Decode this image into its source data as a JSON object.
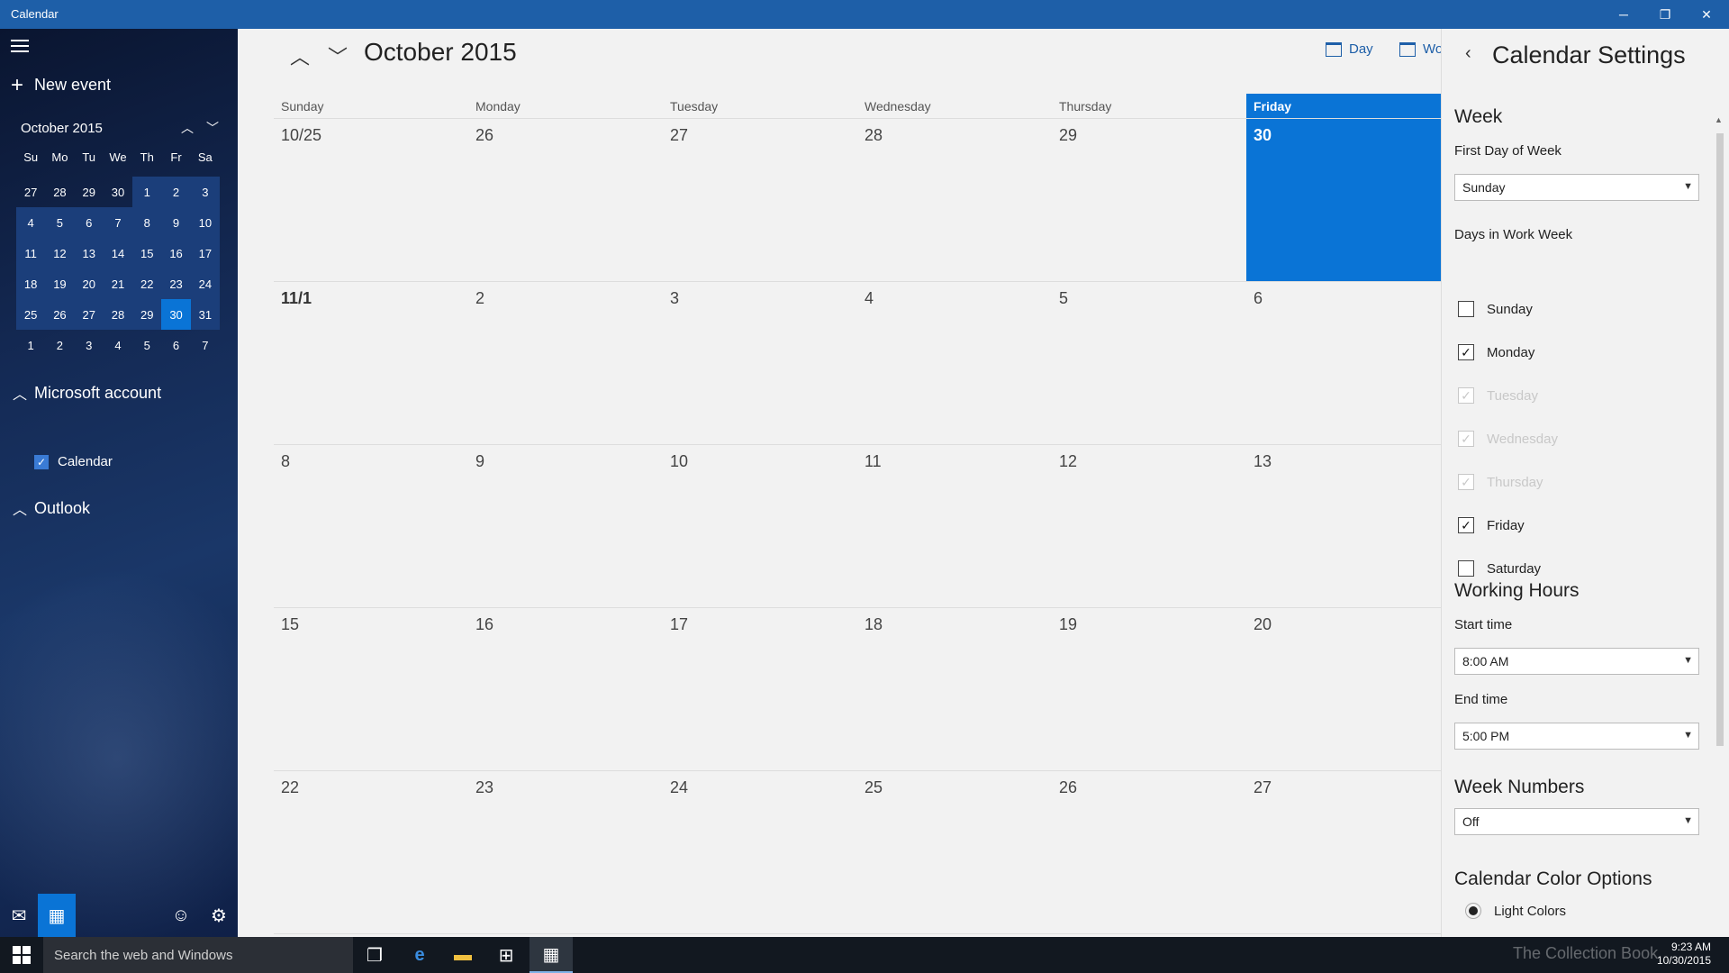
{
  "app": {
    "title": "Calendar"
  },
  "window": {
    "minimize": "─",
    "restore": "❐",
    "close": "✕"
  },
  "sidebar": {
    "new_event": "New event",
    "mini_calendar": {
      "month_label": "October 2015",
      "days_of_week": [
        "Su",
        "Mo",
        "Tu",
        "We",
        "Th",
        "Fr",
        "Sa"
      ],
      "weeks": [
        [
          "27",
          "28",
          "29",
          "30",
          "1",
          "2",
          "3"
        ],
        [
          "4",
          "5",
          "6",
          "7",
          "8",
          "9",
          "10"
        ],
        [
          "11",
          "12",
          "13",
          "14",
          "15",
          "16",
          "17"
        ],
        [
          "18",
          "19",
          "20",
          "21",
          "22",
          "23",
          "24"
        ],
        [
          "25",
          "26",
          "27",
          "28",
          "29",
          "30",
          "31"
        ],
        [
          "1",
          "2",
          "3",
          "4",
          "5",
          "6",
          "7"
        ]
      ],
      "selected": "30"
    },
    "accounts": [
      {
        "name": "Microsoft account",
        "calendars": [
          "Calendar"
        ]
      },
      {
        "name": "Outlook",
        "calendars": []
      }
    ],
    "bottom_icons": [
      "mail-icon",
      "calendar-icon",
      "feedback-icon",
      "settings-icon"
    ]
  },
  "main": {
    "month_title": "October 2015",
    "views": {
      "day": "Day",
      "work_week": "Wor"
    },
    "days_of_week": [
      "Sunday",
      "Monday",
      "Tuesday",
      "Wednesday",
      "Thursday",
      "Friday"
    ],
    "weeks": [
      [
        "10/25",
        "26",
        "27",
        "28",
        "29",
        "30"
      ],
      [
        "11/1",
        "2",
        "3",
        "4",
        "5",
        "6"
      ],
      [
        "8",
        "9",
        "10",
        "11",
        "12",
        "13"
      ],
      [
        "15",
        "16",
        "17",
        "18",
        "19",
        "20"
      ],
      [
        "22",
        "23",
        "24",
        "25",
        "26",
        "27"
      ]
    ],
    "today": "30"
  },
  "settings": {
    "title": "Calendar Settings",
    "week_heading": "Week",
    "first_day_label": "First Day of Week",
    "first_day_value": "Sunday",
    "work_week_label": "Days in Work Week",
    "work_days": [
      {
        "label": "Sunday",
        "checked": false,
        "enabled": true
      },
      {
        "label": "Monday",
        "checked": true,
        "enabled": true
      },
      {
        "label": "Tuesday",
        "checked": true,
        "enabled": false
      },
      {
        "label": "Wednesday",
        "checked": true,
        "enabled": false
      },
      {
        "label": "Thursday",
        "checked": true,
        "enabled": false
      },
      {
        "label": "Friday",
        "checked": true,
        "enabled": true
      },
      {
        "label": "Saturday",
        "checked": false,
        "enabled": true
      }
    ],
    "working_hours_heading": "Working Hours",
    "start_time_label": "Start time",
    "start_time_value": "8:00 AM",
    "end_time_label": "End time",
    "end_time_value": "5:00 PM",
    "week_numbers_heading": "Week Numbers",
    "week_numbers_value": "Off",
    "color_options_heading": "Calendar Color Options",
    "color_option_selected": "Light Colors"
  },
  "taskbar": {
    "search_placeholder": "Search the web and Windows",
    "time": "9:23 AM",
    "date": "10/30/2015",
    "watermark": "The Collection Book"
  },
  "colors": {
    "accent": "#0a74d6",
    "titlebar": "#1e5fa8"
  }
}
